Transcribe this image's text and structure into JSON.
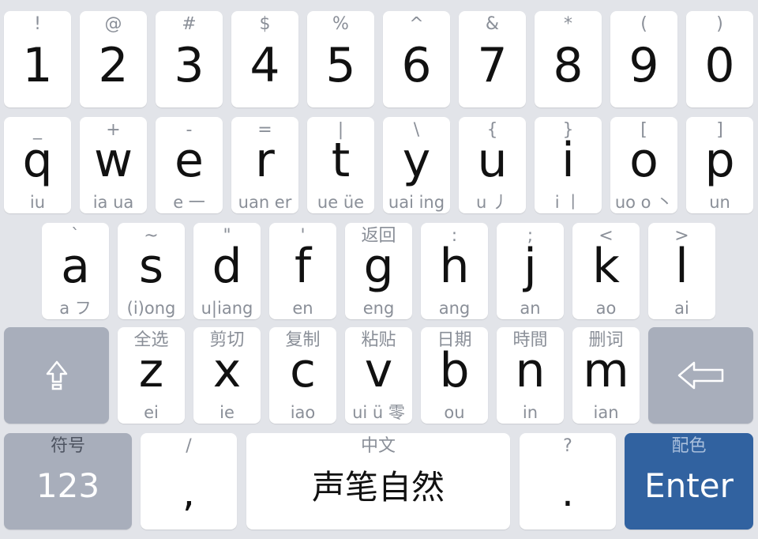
{
  "rows": {
    "numbers": [
      {
        "main": "1",
        "top": "!"
      },
      {
        "main": "2",
        "top": "@"
      },
      {
        "main": "3",
        "top": "#"
      },
      {
        "main": "4",
        "top": "$"
      },
      {
        "main": "5",
        "top": "%"
      },
      {
        "main": "6",
        "top": "^"
      },
      {
        "main": "7",
        "top": "&"
      },
      {
        "main": "8",
        "top": "*"
      },
      {
        "main": "9",
        "top": "("
      },
      {
        "main": "0",
        "top": ")"
      }
    ],
    "qwerty": [
      {
        "main": "q",
        "top": "_",
        "sub": "iu"
      },
      {
        "main": "w",
        "top": "+",
        "sub": "ia ua"
      },
      {
        "main": "e",
        "top": "-",
        "sub": "e 一"
      },
      {
        "main": "r",
        "top": "=",
        "sub": "uan er"
      },
      {
        "main": "t",
        "top": "|",
        "sub": "ue üe"
      },
      {
        "main": "y",
        "top": "\\",
        "sub": "uai ing"
      },
      {
        "main": "u",
        "top": "{",
        "sub": "u 丿"
      },
      {
        "main": "i",
        "top": "}",
        "sub": "i 丨"
      },
      {
        "main": "o",
        "top": "[",
        "sub": "uo o 丶"
      },
      {
        "main": "p",
        "top": "]",
        "sub": "un"
      }
    ],
    "asdf": [
      {
        "main": "a",
        "top": "`",
        "sub": "a フ"
      },
      {
        "main": "s",
        "top": "~",
        "sub": "(i)ong"
      },
      {
        "main": "d",
        "top": "\"",
        "sub": "u|iang"
      },
      {
        "main": "f",
        "top": "'",
        "sub": "en"
      },
      {
        "main": "g",
        "top": "返回",
        "sub": "eng"
      },
      {
        "main": "h",
        "top": ":",
        "sub": "ang"
      },
      {
        "main": "j",
        "top": ";",
        "sub": "an"
      },
      {
        "main": "k",
        "top": "<",
        "sub": "ao"
      },
      {
        "main": "l",
        "top": ">",
        "sub": "ai"
      }
    ],
    "zxcv": [
      {
        "main": "z",
        "top": "全选",
        "sub": "ei"
      },
      {
        "main": "x",
        "top": "剪切",
        "sub": "ie"
      },
      {
        "main": "c",
        "top": "复制",
        "sub": "iao"
      },
      {
        "main": "v",
        "top": "粘贴",
        "sub": "ui ü 零"
      },
      {
        "main": "b",
        "top": "日期",
        "sub": "ou"
      },
      {
        "main": "n",
        "top": "時間",
        "sub": "in"
      },
      {
        "main": "m",
        "top": "删词",
        "sub": "ian"
      }
    ]
  },
  "bottom": {
    "symbols": {
      "top": "符号",
      "main": "123"
    },
    "comma": {
      "top": "/",
      "main": ","
    },
    "space": {
      "top": "中文",
      "main": "声笔自然"
    },
    "period": {
      "top": "?",
      "main": "."
    },
    "enter": {
      "top": "配色",
      "main": "Enter"
    }
  },
  "icons": {
    "shift": "shift-arrow-up-icon",
    "backspace": "backspace-arrow-left-icon"
  },
  "colors": {
    "background": "#e2e4e9",
    "key": "#ffffff",
    "function_key": "#a8aebb",
    "enter": "#3162a0"
  }
}
